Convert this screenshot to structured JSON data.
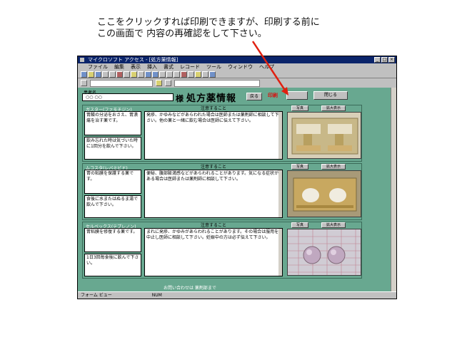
{
  "annotation": {
    "line1": "ここをクリックすれば印刷できますが、印刷する前に",
    "line2": "この画面で 内容の再確認をして下さい。",
    "arrow_color": "#e02010"
  },
  "window": {
    "title": "マイクロソフト アクセス - [処方薬情報]",
    "buttons": [
      "_",
      "□",
      "×"
    ]
  },
  "menu": [
    "ファイル",
    "編集",
    "表示",
    "挿入",
    "書式",
    "レコード",
    "ツール",
    "ウィンドウ",
    "ヘルプ"
  ],
  "form": {
    "name_label": "患者名",
    "name_value": "○○ ○○",
    "sama": "様",
    "title": "処方薬情報",
    "small_button": "戻る",
    "print_label": "印刷",
    "close_button": "閉じる",
    "bg_color": "#68a890"
  },
  "drugs": [
    {
      "name": "ガスター(ファモチジン)",
      "effect_top": "胃酸の分泌をおさえ、胃潰瘍を治す薬です。",
      "effect_bottom": "飲み忘れた時は気づいた時に1回分を飲んで下さい。",
      "notes_header": "注意すること",
      "notes": "発疹、かゆみなどがあらわれた場合は医師または薬剤師に相談して下さい。他の薬と一緒に飲む場合は医師に伝えて下さい。",
      "btn_a": "写真",
      "btn_b": "拡大表示"
    },
    {
      "name": "ムコスタ(レバミピド)",
      "effect_top": "胃の粘膜を保護する薬です。",
      "effect_bottom": "食後に水またはぬるま湯で飲んで下さい。",
      "notes_header": "注意すること",
      "notes": "便秘、腹部膨満感などがあらわれることがあります。気になる症状がある場合は医師または薬剤師に相談して下さい。",
      "btn_a": "写真",
      "btn_b": "拡大表示"
    },
    {
      "name": "セルベックス(テプレノン)",
      "effect_top": "胃粘膜を修復する薬です。",
      "effect_bottom": "1日3回毎食後に飲んで下さい。",
      "notes_header": "注意すること",
      "notes": "まれに発疹、かゆみがあらわれることがあります。その場合は服用を中止し医師に相談して下さい。妊娠中の方は必ず伝えて下さい。",
      "btn_a": "写真",
      "btn_b": "拡大表示"
    }
  ],
  "footer": "お問い合わせは 薬剤部まで",
  "status": [
    "フォーム ビュー",
    "",
    "NUM"
  ]
}
